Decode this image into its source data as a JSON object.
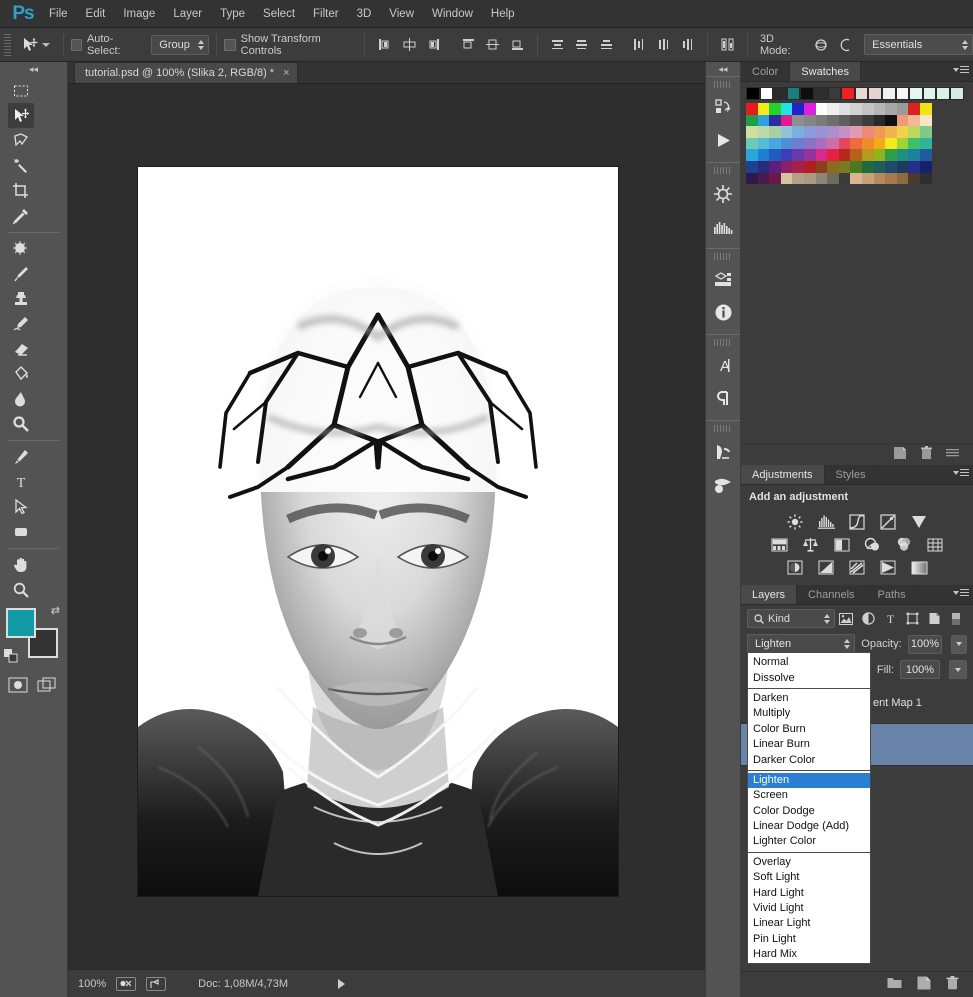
{
  "window": {
    "minimize_label": "–",
    "maximize_label": "□",
    "close_label": "✕"
  },
  "menubar": {
    "logo": "Ps",
    "items": [
      "File",
      "Edit",
      "Image",
      "Layer",
      "Type",
      "Select",
      "Filter",
      "3D",
      "View",
      "Window",
      "Help"
    ]
  },
  "options_bar": {
    "auto_select_label": "Auto-Select:",
    "auto_select_value": "Group",
    "show_transform_label": "Show Transform Controls",
    "mode_3d_label": "3D Mode:",
    "workspace": "Essentials"
  },
  "toolbox": {
    "tools": [
      {
        "name": "rectangular-marquee-tool"
      },
      {
        "name": "move-tool",
        "selected": true
      },
      {
        "name": "lasso-tool"
      },
      {
        "name": "magic-wand-tool"
      },
      {
        "name": "crop-tool"
      },
      {
        "name": "eyedropper-tool"
      },
      {
        "name": "spot-healing-brush-tool"
      },
      {
        "name": "brush-tool"
      },
      {
        "name": "clone-stamp-tool"
      },
      {
        "name": "history-brush-tool"
      },
      {
        "name": "eraser-tool"
      },
      {
        "name": "paint-bucket-tool"
      },
      {
        "name": "blur-tool"
      },
      {
        "name": "dodge-tool"
      },
      {
        "name": "pen-tool"
      },
      {
        "name": "horizontal-type-tool"
      },
      {
        "name": "path-selection-tool"
      },
      {
        "name": "rectangle-tool"
      },
      {
        "name": "hand-tool"
      },
      {
        "name": "zoom-tool"
      }
    ],
    "foreground_color": "#119aa6",
    "background_color": "#333333",
    "quick_mask_name": "edit-in-quick-mask-mode",
    "screen_mode_name": "change-screen-mode"
  },
  "document": {
    "tab_title": "tutorial.psd @ 100% (Slika 2, RGB/8) *",
    "close_label": "×"
  },
  "status_bar": {
    "zoom": "100%",
    "doc_info": "Doc: 1,08M/4,73M"
  },
  "mini_dock": {
    "collapse_label": "◂◂",
    "icons": [
      "history-icon",
      "actions-play-icon",
      "adjustments-gear-icon",
      "histogram-icon",
      "3d-properties-icon",
      "info-icon",
      "character-icon",
      "paragraph-icon",
      "clone-source-icon",
      "brush-presets-icon"
    ]
  },
  "color_panel": {
    "tabs": [
      {
        "label": "Color",
        "active": false
      },
      {
        "label": "Swatches",
        "active": true
      }
    ],
    "top_row": [
      "#000000",
      "#ffffff",
      "#2b2b2b",
      "#1c7d7f",
      "#0e0e0e",
      "#2e2e2e",
      "#3a3a3a",
      "#ee2222",
      "#e8d7d7",
      "#e3d3d3",
      "#f0f0f0",
      "#f7f7f7",
      "#e7f5f0",
      "#dff3ec",
      "#d9f0e7",
      "#d3ece2"
    ],
    "grid": [
      [
        "#e51c1c",
        "#f5ea1c",
        "#27d12a",
        "#22e2e2",
        "#2222cc",
        "#e020e0",
        "#ffffff",
        "#efefef",
        "#e0e0e0",
        "#d2d2d2",
        "#c4c4c4",
        "#b6b6b6",
        "#a8a8a8",
        "#9a9a9a",
        "#d8241c",
        "#f2e21c"
      ],
      [
        "#1f9e4a",
        "#2f9fe0",
        "#2a2f9e",
        "#e01b8b",
        "#8f8f8f",
        "#858585",
        "#7b7b7b",
        "#6e6e6e",
        "#5f5f5f",
        "#4f4f4f",
        "#3d3d3d",
        "#2a2a2a",
        "#111111",
        "#f0987a",
        "#f5b79a",
        "#f7e7c4"
      ],
      [
        "#ccdfa0",
        "#bdd9a8",
        "#a9cfa5",
        "#8fc6d6",
        "#7ab0dd",
        "#8a9ddb",
        "#9b91d4",
        "#ad8fcc",
        "#c78fc4",
        "#e39bb4",
        "#ef8a7a",
        "#f09a55",
        "#efb64f",
        "#f0d24f",
        "#bcd85c",
        "#7fc98c"
      ],
      [
        "#6ec9b8",
        "#55bcd8",
        "#4aa7dd",
        "#4e8ed6",
        "#6a7fcf",
        "#8a72c6",
        "#a86fbc",
        "#cc6fa8",
        "#e5475f",
        "#ef6a3c",
        "#f08a2a",
        "#f5a81c",
        "#f5e81c",
        "#9fd432",
        "#3fbf6a",
        "#2fb39b"
      ],
      [
        "#2aa6dd",
        "#1f7fd0",
        "#1f5cc0",
        "#3a3fb5",
        "#6a37ad",
        "#9432a0",
        "#d62a8e",
        "#e5213f",
        "#b52a1c",
        "#b5631c",
        "#b59b1c",
        "#8fb51c",
        "#2f9e4a",
        "#1f8f7f",
        "#1f7f9e",
        "#1f5c9e"
      ],
      [
        "#1f3f8f",
        "#2a2a7a",
        "#5c1f7a",
        "#8a1f6a",
        "#a81f4a",
        "#b01f1f",
        "#8a3f1f",
        "#8a6a1f",
        "#7a7a1f",
        "#4a7a1f",
        "#1f6a3f",
        "#1f5c5c",
        "#1f4a6a",
        "#1f3a5c",
        "#252e8a",
        "#1a1f6a"
      ],
      [
        "#2b1a4a",
        "#4a1a4a",
        "#6a1a4a",
        "#d9c2a0",
        "#b5a087",
        "#a89a85",
        "#8f8577",
        "#6e6a5f",
        "#3a3a3a",
        "#d9b68f",
        "#c9a077",
        "#b58a5f",
        "#a87a4a",
        "#8f6a3f",
        "#4a3a2a",
        "#2e2e2e"
      ]
    ]
  },
  "adjustments_panel": {
    "tabs": [
      {
        "label": "Adjustments",
        "active": true
      },
      {
        "label": "Styles",
        "active": false
      }
    ],
    "heading": "Add an adjustment",
    "row1": [
      "brightness-contrast-icon",
      "levels-icon",
      "curves-icon",
      "exposure-icon",
      "vibrance-icon"
    ],
    "row2": [
      "hue-saturation-icon",
      "color-balance-icon",
      "black-white-icon",
      "photo-filter-icon",
      "channel-mixer-icon",
      "color-lookup-icon"
    ],
    "row3": [
      "invert-icon",
      "posterize-icon",
      "threshold-icon",
      "selective-color-icon",
      "gradient-map-icon"
    ],
    "toolbar_icons": [
      "new-adjustment-layer-icon",
      "delete-adjustment-icon",
      "panel-options-icon"
    ]
  },
  "layers_panel": {
    "tabs": [
      {
        "label": "Layers",
        "active": true
      },
      {
        "label": "Channels",
        "active": false
      },
      {
        "label": "Paths",
        "active": false
      }
    ],
    "filter_label": "Kind",
    "filter_icons": [
      "filter-pixel-icon",
      "filter-adjustment-icon",
      "filter-type-icon",
      "filter-shape-icon",
      "filter-smart-object-icon",
      "filter-toggle-icon"
    ],
    "blend_mode": "Lighten",
    "opacity_label": "Opacity:",
    "opacity_value": "100%",
    "fill_label": "Fill:",
    "fill_value": "100%",
    "layers": [
      {
        "name": "ent Map 1",
        "selected": false
      },
      {
        "name": "",
        "selected": true
      }
    ],
    "bottom_icons": [
      "new-group-icon",
      "new-layer-icon",
      "delete-layer-icon"
    ]
  },
  "blend_dropdown": {
    "groups": [
      [
        "Normal",
        "Dissolve"
      ],
      [
        "Darken",
        "Multiply",
        "Color Burn",
        "Linear Burn",
        "Darker Color"
      ],
      [
        "Lighten",
        "Screen",
        "Color Dodge",
        "Linear Dodge (Add)",
        "Lighter Color"
      ],
      [
        "Overlay",
        "Soft Light",
        "Hard Light",
        "Vivid Light",
        "Linear Light",
        "Pin Light",
        "Hard Mix"
      ]
    ],
    "selected": "Lighten"
  }
}
